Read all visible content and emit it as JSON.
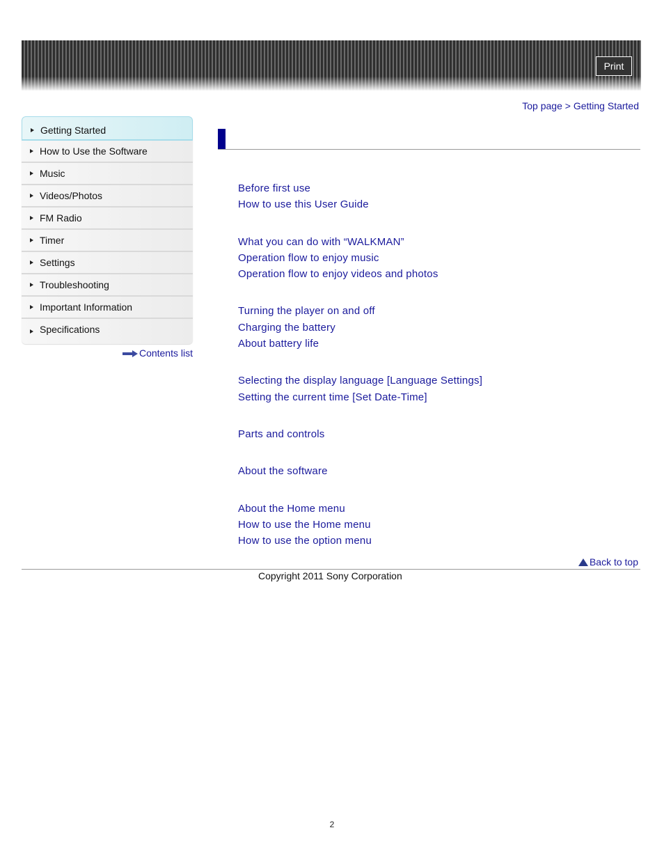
{
  "header": {
    "print_label": "Print"
  },
  "breadcrumb": {
    "items": [
      "Top page",
      "Getting Started"
    ],
    "separator": ">"
  },
  "sidebar": {
    "items": [
      {
        "label": "Getting Started",
        "active": true
      },
      {
        "label": "How to Use the Software"
      },
      {
        "label": "Music"
      },
      {
        "label": "Videos/Photos"
      },
      {
        "label": "FM Radio"
      },
      {
        "label": "Timer"
      },
      {
        "label": "Settings"
      },
      {
        "label": "Troubleshooting"
      },
      {
        "label": "Important Information"
      },
      {
        "label": "Specifications"
      }
    ],
    "contents_list_label": "Contents list"
  },
  "main": {
    "title": "",
    "groups": [
      {
        "links": [
          "Before first use",
          "How to use this User Guide"
        ]
      },
      {
        "links": [
          "What you can do with “WALKMAN”",
          "Operation flow to enjoy music",
          "Operation flow to enjoy videos and photos"
        ]
      },
      {
        "links": [
          "Turning the player on and off",
          "Charging the battery",
          "About battery life"
        ]
      },
      {
        "links": [
          "Selecting the display language [Language Settings]",
          "Setting the current time [Set Date-Time]"
        ]
      },
      {
        "links": [
          "Parts and controls"
        ]
      },
      {
        "links": [
          "About the software"
        ]
      },
      {
        "links": [
          "About the Home menu",
          "How to use the Home menu",
          "How to use the option menu"
        ]
      }
    ],
    "back_to_top_label": "Back to top"
  },
  "footer": {
    "copyright": "Copyright 2011 Sony Corporation",
    "page_number": "2"
  },
  "colors": {
    "link": "#1a1a9c",
    "heading_bar": "#00008c",
    "active_sidebar": "#d8f1f5"
  }
}
